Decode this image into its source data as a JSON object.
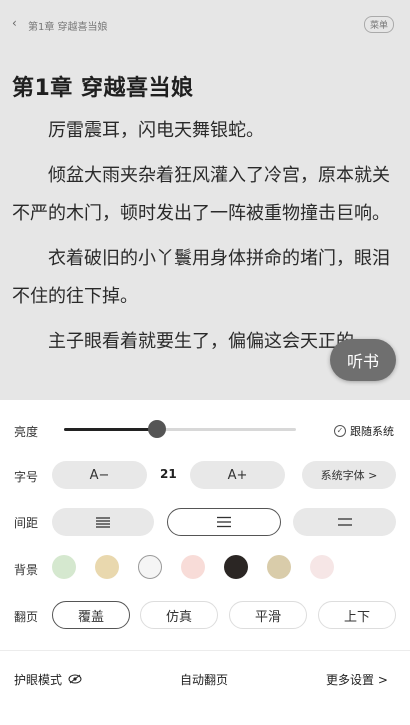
{
  "header": {
    "back_icon": "chevron-left-icon",
    "breadcrumb": "第1章 穿越喜当娘",
    "menu_label": "菜单"
  },
  "chapter": {
    "title": "第1章  穿越喜当娘",
    "paragraphs": [
      "厉雷震耳，闪电天舞银蛇。",
      "倾盆大雨夹杂着狂风灌入了冷宫，原本就关不严的木门，顿时发出了一阵被重物撞击巨响。",
      "衣着破旧的小丫鬟用身体拼命的堵门，眼泪不住的往下掉。",
      "主子眼看着就要生了，偏偏这会天正的"
    ]
  },
  "listen_button": "听书",
  "settings": {
    "brightness": {
      "label": "亮度",
      "level": 0.4,
      "follow_system_label": "跟随系统",
      "follow_system_checked": true
    },
    "font": {
      "label": "字号",
      "decrease_label": "A−",
      "value": "21",
      "increase_label": "A+",
      "family_label": "系统字体 >"
    },
    "spacing": {
      "label": "间距",
      "options": [
        "compact",
        "medium",
        "wide"
      ],
      "selected_index": 1
    },
    "background": {
      "label": "背景",
      "colors": [
        "#d5e8cf",
        "#e9d8ae",
        "#f5f5f5",
        "#f8dcd8",
        "#2b2624",
        "#d9ccaa",
        "#f6e6e6"
      ],
      "selected_index": 2
    },
    "page_turn": {
      "label": "翻页",
      "options": [
        "覆盖",
        "仿真",
        "平滑",
        "上下"
      ],
      "selected_index": 0
    }
  },
  "bottom_bar": {
    "eye_mode_label": "护眼模式",
    "eye_icon": "eye-off-icon",
    "auto_page_label": "自动翻页",
    "more_settings_label": "更多设置 >"
  }
}
